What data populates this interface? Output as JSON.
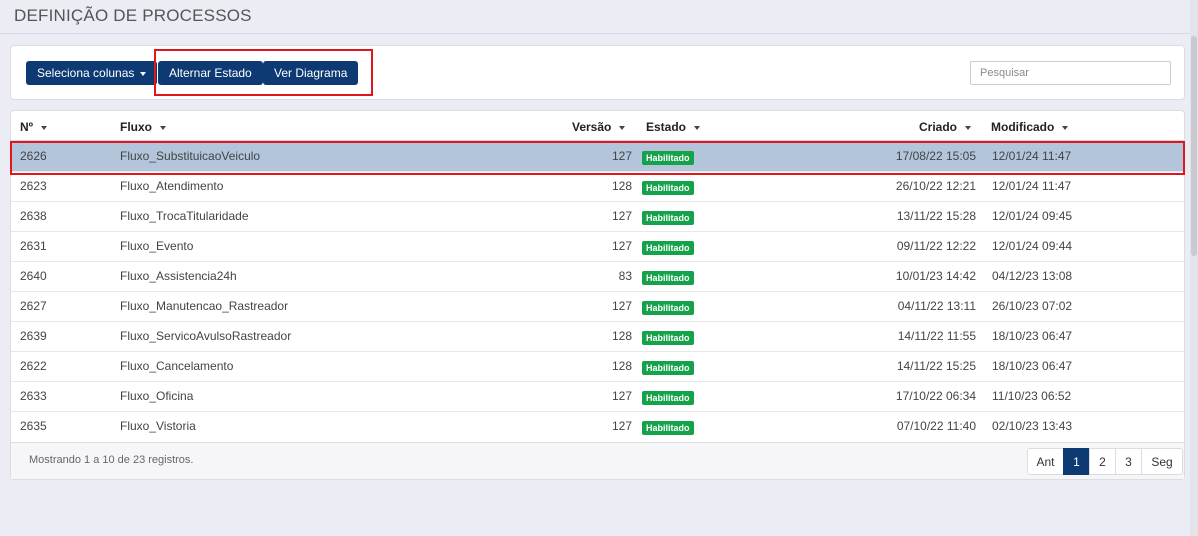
{
  "page": {
    "title": "DEFINIÇÃO DE PROCESSOS"
  },
  "toolbar": {
    "columns_label": "Seleciona colunas",
    "toggle_state_label": "Alternar Estado",
    "view_diagram_label": "Ver Diagrama",
    "search_placeholder": "Pesquisar",
    "search_value": ""
  },
  "table": {
    "headers": {
      "num": "Nº",
      "flow": "Fluxo",
      "version": "Versão",
      "state": "Estado",
      "created": "Criado",
      "modified": "Modificado"
    },
    "rows": [
      {
        "num": "2626",
        "flow": "Fluxo_SubstituicaoVeiculo",
        "version": "127",
        "state": "Habilitado",
        "created": "17/08/22 15:05",
        "modified": "12/01/24 11:47",
        "selected": true
      },
      {
        "num": "2623",
        "flow": "Fluxo_Atendimento",
        "version": "128",
        "state": "Habilitado",
        "created": "26/10/22 12:21",
        "modified": "12/01/24 11:47"
      },
      {
        "num": "2638",
        "flow": "Fluxo_TrocaTitularidade",
        "version": "127",
        "state": "Habilitado",
        "created": "13/11/22 15:28",
        "modified": "12/01/24 09:45"
      },
      {
        "num": "2631",
        "flow": "Fluxo_Evento",
        "version": "127",
        "state": "Habilitado",
        "created": "09/11/22 12:22",
        "modified": "12/01/24 09:44"
      },
      {
        "num": "2640",
        "flow": "Fluxo_Assistencia24h",
        "version": "83",
        "state": "Habilitado",
        "created": "10/01/23 14:42",
        "modified": "04/12/23 13:08"
      },
      {
        "num": "2627",
        "flow": "Fluxo_Manutencao_Rastreador",
        "version": "127",
        "state": "Habilitado",
        "created": "04/11/22 13:11",
        "modified": "26/10/23 07:02"
      },
      {
        "num": "2639",
        "flow": "Fluxo_ServicoAvulsoRastreador",
        "version": "128",
        "state": "Habilitado",
        "created": "14/11/22 11:55",
        "modified": "18/10/23 06:47"
      },
      {
        "num": "2622",
        "flow": "Fluxo_Cancelamento",
        "version": "128",
        "state": "Habilitado",
        "created": "14/11/22 15:25",
        "modified": "18/10/23 06:47"
      },
      {
        "num": "2633",
        "flow": "Fluxo_Oficina",
        "version": "127",
        "state": "Habilitado",
        "created": "17/10/22 06:34",
        "modified": "11/10/23 06:52"
      },
      {
        "num": "2635",
        "flow": "Fluxo_Vistoria",
        "version": "127",
        "state": "Habilitado",
        "created": "07/10/22 11:40",
        "modified": "02/10/23 13:43"
      }
    ]
  },
  "footer": {
    "summary": "Mostrando 1 a 10 de 23 registros.",
    "pagination": {
      "prev": "Ant",
      "pages": [
        "1",
        "2",
        "3"
      ],
      "current": "1",
      "next": "Seg"
    }
  },
  "colors": {
    "primary": "#0d3a73",
    "badge": "#14a34a",
    "selected_row": "#b3c5db",
    "highlight": "#e0161b"
  }
}
